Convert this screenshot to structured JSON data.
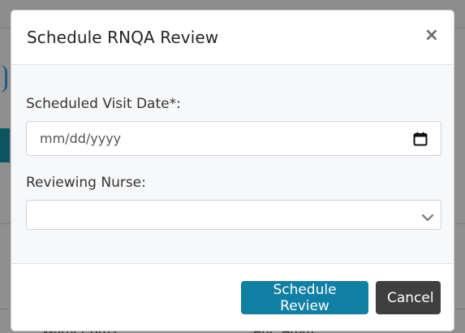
{
  "modal": {
    "title": "Schedule RNQA Review",
    "close_symbol": "×",
    "fields": {
      "visit_date": {
        "label": "Scheduled Visit Date*:",
        "placeholder": "mm/dd/yyyy",
        "icon": "calendar-icon"
      },
      "reviewing_nurse": {
        "label": "Reviewing Nurse:",
        "value": "",
        "icon": "chevron-down-icon"
      }
    },
    "buttons": {
      "schedule": "Schedule Review",
      "cancel": "Cancel"
    }
  },
  "background": {
    "left_text": "Warner Bros",
    "right_text": "Ant, Atom"
  },
  "colors": {
    "primary": "#0f7fa4",
    "secondary": "#3f3f3f",
    "overlay": "#8f8f8f"
  }
}
